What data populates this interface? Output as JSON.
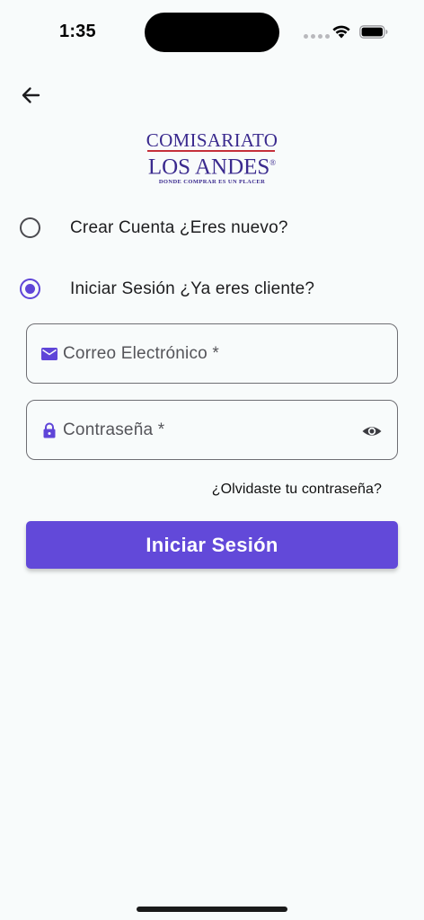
{
  "status_bar": {
    "time": "1:35"
  },
  "logo": {
    "line1": "COMISARIATO",
    "line2": "LOS ANDES",
    "registered": "®",
    "tagline": "DONDE COMPRAR ES UN PLACER"
  },
  "options": [
    {
      "label": "Crear Cuenta ¿Eres nuevo?",
      "checked": false
    },
    {
      "label": "Iniciar Sesión ¿Ya eres cliente?",
      "checked": true
    }
  ],
  "form": {
    "email_placeholder": "Correo Electrónico *",
    "password_placeholder": "Contraseña *",
    "forgot_label": "¿Olvidaste tu contraseña?",
    "submit_label": "Iniciar Sesión"
  },
  "colors": {
    "accent": "#6249d9",
    "logo_text": "#3a2a8e",
    "logo_rule": "#c5303a"
  },
  "icons": {
    "back": "arrow-left-icon",
    "email": "envelope-icon",
    "password": "lock-icon",
    "visibility": "eye-icon"
  }
}
